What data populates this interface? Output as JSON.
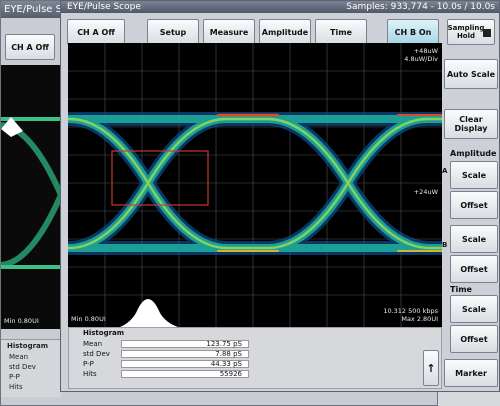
{
  "back": {
    "title": "EYE/Pulse Sc",
    "ch_a": "CH A Off",
    "min": "Min 0.80UI",
    "hist_title": "Histogram",
    "rows": [
      "Mean",
      "std Dev",
      "P-P",
      "Hits"
    ]
  },
  "main": {
    "title": "EYE/Pulse Scope",
    "samples": "Samples: 933,774 - 10.0s / 10.0s",
    "toolbar": {
      "ch_a": "CH A Off",
      "setup": "Setup",
      "measure": "Measure",
      "amplitude": "Amplitude",
      "time": "Time",
      "ch_b": "CH B On",
      "sampling_hold": "Sampling Hold"
    },
    "plot": {
      "top_right_1": "+48uW",
      "top_right_2": "4.8uW/Div",
      "mid_right": "+24uW",
      "bottom_left": "Min 0.80UI",
      "bottom_right_1": "10.312 500 kbps",
      "bottom_right_2": "Max 2.80UI"
    },
    "histogram": {
      "title": "Histogram",
      "rows": [
        {
          "label": "Mean",
          "value": "123.75 pS"
        },
        {
          "label": "std Dev",
          "value": "7.88 pS"
        },
        {
          "label": "P-P",
          "value": "44.33 pS"
        },
        {
          "label": "Hits",
          "value": "55926"
        }
      ]
    },
    "side": {
      "auto_scale": "Auto Scale",
      "clear_display": "Clear Display",
      "amplitude_label": "Amplitude",
      "a_marker": "A",
      "b_marker": "B",
      "scale": "Scale",
      "offset": "Offset",
      "time_label": "Time",
      "marker": "Marker"
    }
  }
}
